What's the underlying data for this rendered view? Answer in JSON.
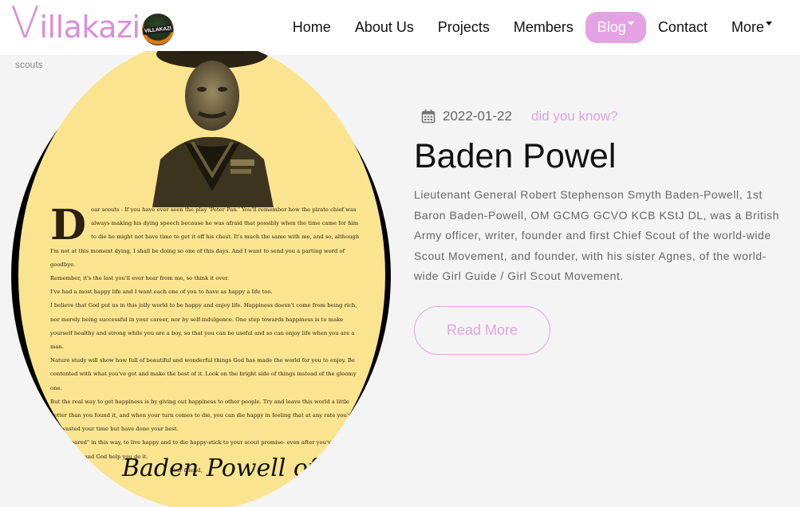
{
  "brand": {
    "first_letter": "V",
    "rest": "illakazi",
    "badge_text": "VILLAKAZI"
  },
  "nav": {
    "items": [
      {
        "label": "Home"
      },
      {
        "label": "About Us"
      },
      {
        "label": "Projects"
      },
      {
        "label": "Members"
      },
      {
        "label": "Blog",
        "active": true
      },
      {
        "label": "Contact"
      },
      {
        "label": "More"
      }
    ]
  },
  "breadcrumb": "scouts",
  "post": {
    "date": "2022-01-22",
    "category": "did you know?",
    "title": "Baden Powel",
    "body": "Lieutenant General Robert Stephenson Smyth Baden-Powell, 1st Baron Baden-Powell, OM GCMG GCVO KCB KStJ DL, was a British Army officer, writer, founder and first Chief Scout of the world-wide Scout Movement, and founder, with his sister Agnes, of the world-wide Girl Guide / Girl Scout Movement.",
    "read_more": "Read More"
  },
  "image": {
    "drop_cap": "D",
    "paragraphs": [
      "ear scouts - If you have ever seen the play 'Peter Pan.' You'll remember how the pirate chief was always making his dying speech because he was afraid that possibly when the time came for him to die he might not have time to get it off his chest. It's much the same with me, and so, although I'm not at this moment dying, I shall be doing so one of this days. And I want to send you a parting word of goodbye.",
      "Remember, it's the last you'll ever hear from me, so think it over.",
      "I've had a most happy life and I want each one of you to have as happy a life too.",
      "I believe that God put us in this jolly world to be happy and enjoy life. Happiness doesn't come from being rich, nor merely being successful in your career, nor by self-indulgence. One step towards happiness is to make yourself healthy and strong while you are a boy, so that you can be useful and so can enjoy life when you are a man.",
      "Nature study will show how full of beautiful and wonderful things God has made the world for you to enjoy. Be contented with what you've got and make the best of it. Look on the bright side of things instead of the gloomy one.",
      "But the real way to get happiness is by giving out happiness to other people. Try and leave this world a little better than you found it, and when your turn comes to die, you can die happy in feeling that at any rate you've not wasted your time but have done your best.",
      "\"Be prepared\" in this way, to live happy and to die happy-stick to your scout promise- even after you've ceased to be a boy- and God help you do it.",
      "Your friend,"
    ],
    "signature": "Baden Powell of Gilwell"
  },
  "colors": {
    "accent": "#e4a2e4",
    "accent_text": "#e0a5e0",
    "background": "#f4f4f4",
    "letter_paper": "#fbe48f"
  },
  "icons": {
    "date": "calendar-icon",
    "dropdown": "caret-down-icon"
  }
}
